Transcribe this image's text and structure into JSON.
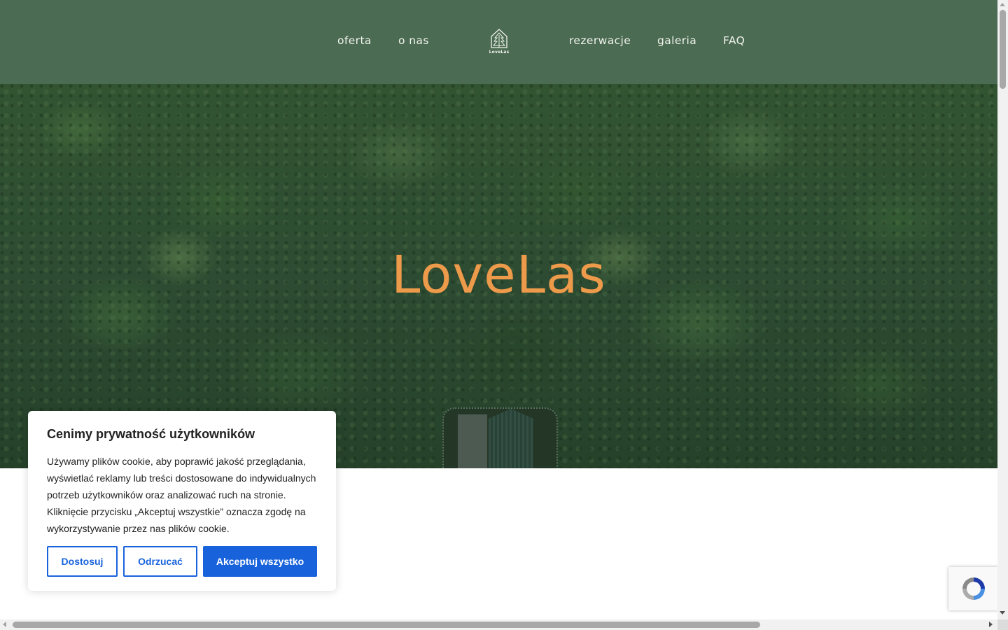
{
  "nav": {
    "left": [
      "oferta",
      "o nas"
    ],
    "right": [
      "rezerwacje",
      "galeria",
      "FAQ"
    ],
    "logo_text": "LoveLas"
  },
  "hero": {
    "title": "LoveLas"
  },
  "cookie_banner": {
    "title": "Cenimy prywatność użytkowników",
    "body": "Używamy plików cookie, aby poprawić jakość przeglądania, wyświetlać reklamy lub treści dostosowane do indywidualnych potrzeb użytkowników oraz analizować ruch na stronie. Kliknięcie przycisku „Akceptuj wszystkie” oznacza zgodę na wykorzystywanie przez nas plików cookie.",
    "customize_label": "Dostosuj",
    "reject_label": "Odrzucać",
    "accept_label": "Akceptuj wszystko"
  },
  "colors": {
    "header_bg": "#4b6b52",
    "hero_title": "#ee9a4b",
    "accent": "#1863dc"
  },
  "icons": [
    "tree-logo-icon",
    "recaptcha-icon"
  ]
}
